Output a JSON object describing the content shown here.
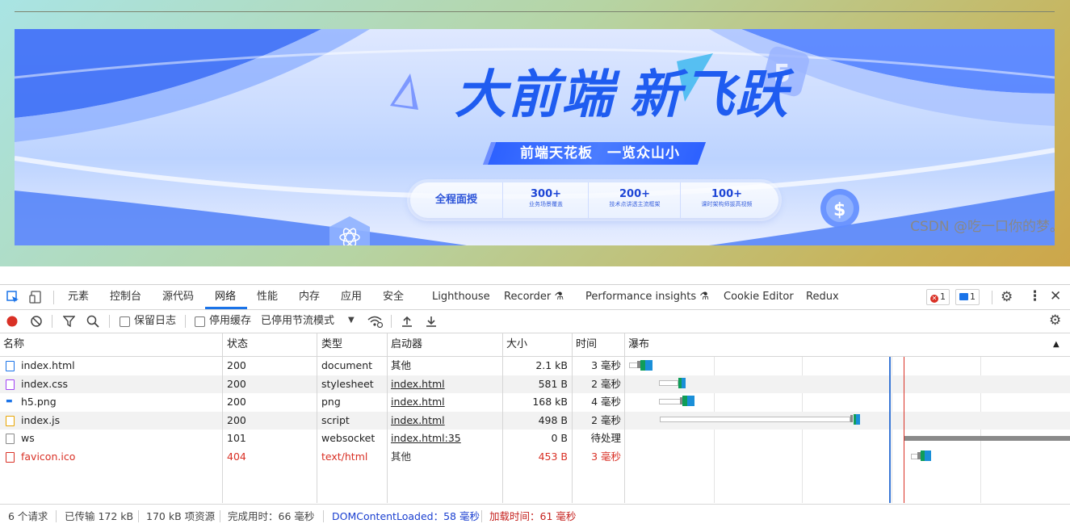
{
  "banner": {
    "title_part1": "大前端",
    "title_part2": "新飞跃",
    "subtitle": "前端天花板　一览众山小",
    "pill": [
      {
        "main": "全程面授"
      },
      {
        "num": "300+",
        "desc": "业务场景覆盖"
      },
      {
        "num": "200+",
        "desc": "技术点讲透主流框架"
      },
      {
        "num": "100+",
        "desc": "课时架构师拔高视频"
      }
    ]
  },
  "devtools": {
    "tabs": [
      "元素",
      "控制台",
      "源代码",
      "网络",
      "性能",
      "内存",
      "应用",
      "安全",
      "Lighthouse",
      "Recorder",
      "Performance insights",
      "Cookie Editor",
      "Redux"
    ],
    "active_tab": "网络",
    "error_count": "1",
    "message_count": "1",
    "toolbar": {
      "preserve_log": "保留日志",
      "disable_cache": "停用缓存",
      "throttling": "已停用节流模式"
    },
    "columns": [
      "名称",
      "状态",
      "类型",
      "启动器",
      "大小",
      "时间",
      "瀑布"
    ],
    "requests": [
      {
        "name": "index.html",
        "status": "200",
        "type": "document",
        "initiator": "其他",
        "initiator_link": false,
        "size": "2.1 kB",
        "time": "3 毫秒",
        "error": false
      },
      {
        "name": "index.css",
        "status": "200",
        "type": "stylesheet",
        "initiator": "index.html",
        "initiator_link": true,
        "size": "581 B",
        "time": "2 毫秒",
        "error": false
      },
      {
        "name": "h5.png",
        "status": "200",
        "type": "png",
        "initiator": "index.html",
        "initiator_link": true,
        "size": "168 kB",
        "time": "4 毫秒",
        "error": false
      },
      {
        "name": "index.js",
        "status": "200",
        "type": "script",
        "initiator": "index.html",
        "initiator_link": true,
        "size": "498 B",
        "time": "2 毫秒",
        "error": false
      },
      {
        "name": "ws",
        "status": "101",
        "type": "websocket",
        "initiator": "index.html:35",
        "initiator_link": true,
        "size": "0 B",
        "time": "待处理",
        "error": false
      },
      {
        "name": "favicon.ico",
        "status": "404",
        "type": "text/html",
        "initiator": "其他",
        "initiator_link": false,
        "size": "453 B",
        "time": "3 毫秒",
        "error": true
      }
    ],
    "statusbar": {
      "requests": "6 个请求",
      "transferred": "已传输 172 kB",
      "resources": "170 kB 项资源",
      "finish": "完成用时：66 毫秒",
      "dcl": "DOMContentLoaded：58 毫秒",
      "load": "加载时间：61 毫秒"
    }
  },
  "watermark": "CSDN @吃一口你的梦。",
  "colors": {
    "accent": "#1a73e8",
    "error": "#d93025",
    "banner_blue": "#1f5cf0"
  }
}
